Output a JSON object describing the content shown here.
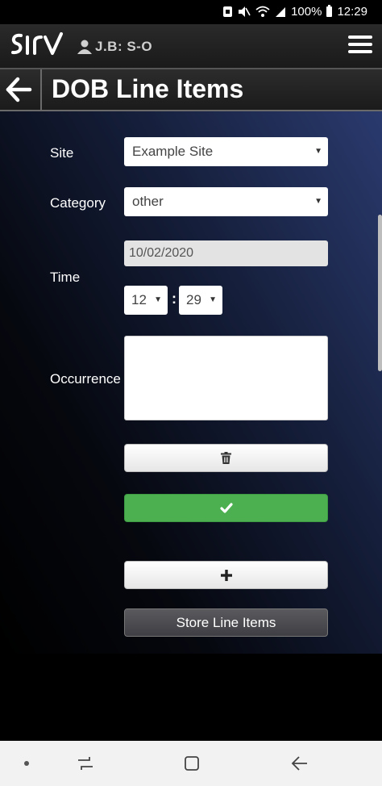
{
  "status_bar": {
    "battery_percent": "100%",
    "time": "12:29"
  },
  "header": {
    "user_label": "J.B: S-O"
  },
  "title_bar": {
    "title": "DOB Line Items"
  },
  "form": {
    "site": {
      "label": "Site",
      "selected": "Example Site"
    },
    "category": {
      "label": "Category",
      "selected": "other"
    },
    "time": {
      "label": "Time",
      "date_value": "10/02/2020",
      "hour_selected": "12",
      "separator": ":",
      "minute_selected": "29"
    },
    "occurrence": {
      "label": "Occurrence",
      "value": ""
    }
  },
  "buttons": {
    "store_label": "Store Line Items"
  },
  "colors": {
    "confirm": "#4caf50",
    "store": "#4a4a50",
    "header": "#222222"
  }
}
